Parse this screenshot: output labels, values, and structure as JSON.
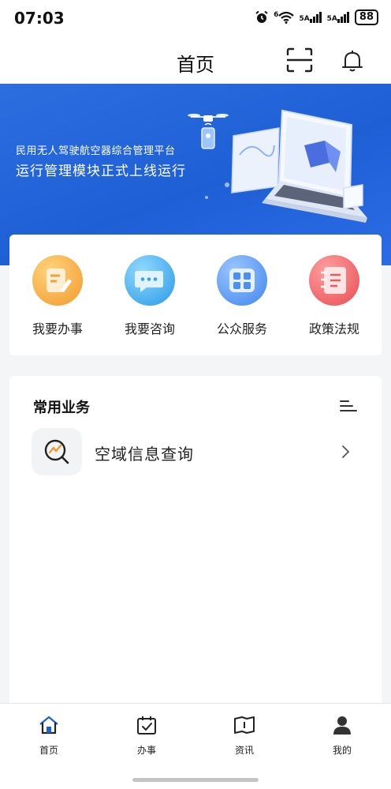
{
  "status_bar": {
    "time": "07:03",
    "network_1": "5A",
    "network_2": "5A",
    "wifi_badge": "6",
    "battery": "88"
  },
  "nav": {
    "title": "首页",
    "scan_icon": "scan-icon",
    "bell_icon": "bell-icon"
  },
  "banner": {
    "line1": "民用无人驾驶航空器综合管理平台",
    "line2": "运行管理模块正式上线运行"
  },
  "quick_actions": [
    {
      "label": "我要办事",
      "icon": "document-pen-icon",
      "color": "#f6a63a"
    },
    {
      "label": "我要咨询",
      "icon": "chat-bubble-icon",
      "color": "#3aa8ec"
    },
    {
      "label": "公众服务",
      "icon": "grid-apps-icon",
      "color": "#4d95f0"
    },
    {
      "label": "政策法规",
      "icon": "notebook-icon",
      "color": "#ee5a5e"
    }
  ],
  "common_services": {
    "title": "常用业务",
    "items": [
      {
        "label": "空域信息查询",
        "icon": "chart-search-icon"
      }
    ]
  },
  "tab_bar": {
    "tabs": [
      {
        "label": "首页",
        "icon": "home-icon",
        "active": true
      },
      {
        "label": "办事",
        "icon": "calendar-check-icon",
        "active": false
      },
      {
        "label": "资讯",
        "icon": "book-icon",
        "active": false
      },
      {
        "label": "我的",
        "icon": "user-icon",
        "active": false
      }
    ]
  },
  "colors": {
    "banner_blue": "#2563d9",
    "accent_blue": "#1f5fd6"
  }
}
